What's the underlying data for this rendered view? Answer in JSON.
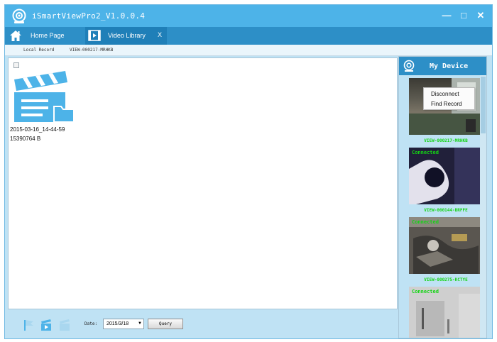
{
  "window": {
    "title": "iSmartViewPro2_V1.0.0.4",
    "minimize_label": "—",
    "maximize_label": "□",
    "close_label": "✕"
  },
  "tabs": [
    {
      "label": "Home Page",
      "icon": "home-icon",
      "closable": false
    },
    {
      "label": "Video Library",
      "icon": "video-library-icon",
      "closable": true,
      "close_label": "X"
    }
  ],
  "subnav": {
    "local_record": "Local Record",
    "device_id": "VIEW-000217-MRHKB"
  },
  "records": [
    {
      "name": "2015-03-16_14-44-59",
      "size": "15390764 B",
      "checked": false
    }
  ],
  "toolbar": {
    "date_label": "Date:",
    "date_value": "2015/3/18",
    "query_label": "Query"
  },
  "device_panel": {
    "title": "My Device",
    "devices": [
      {
        "id": "VIEW-000217-MRHKB",
        "status": ""
      },
      {
        "id": "VIEW-000144-BRFFE",
        "status": "Connected"
      },
      {
        "id": "VIEW-000275-KCTYE",
        "status": "Connected"
      },
      {
        "id": "",
        "status": "Connected"
      }
    ]
  },
  "context_menu": {
    "items": [
      "Disconnect",
      "Find Record"
    ]
  },
  "colors": {
    "title_bar": "#4db3e8",
    "tab_bar": "#2d8fc7",
    "panel_bg": "#bfe2f4",
    "status_green": "#14d414"
  }
}
